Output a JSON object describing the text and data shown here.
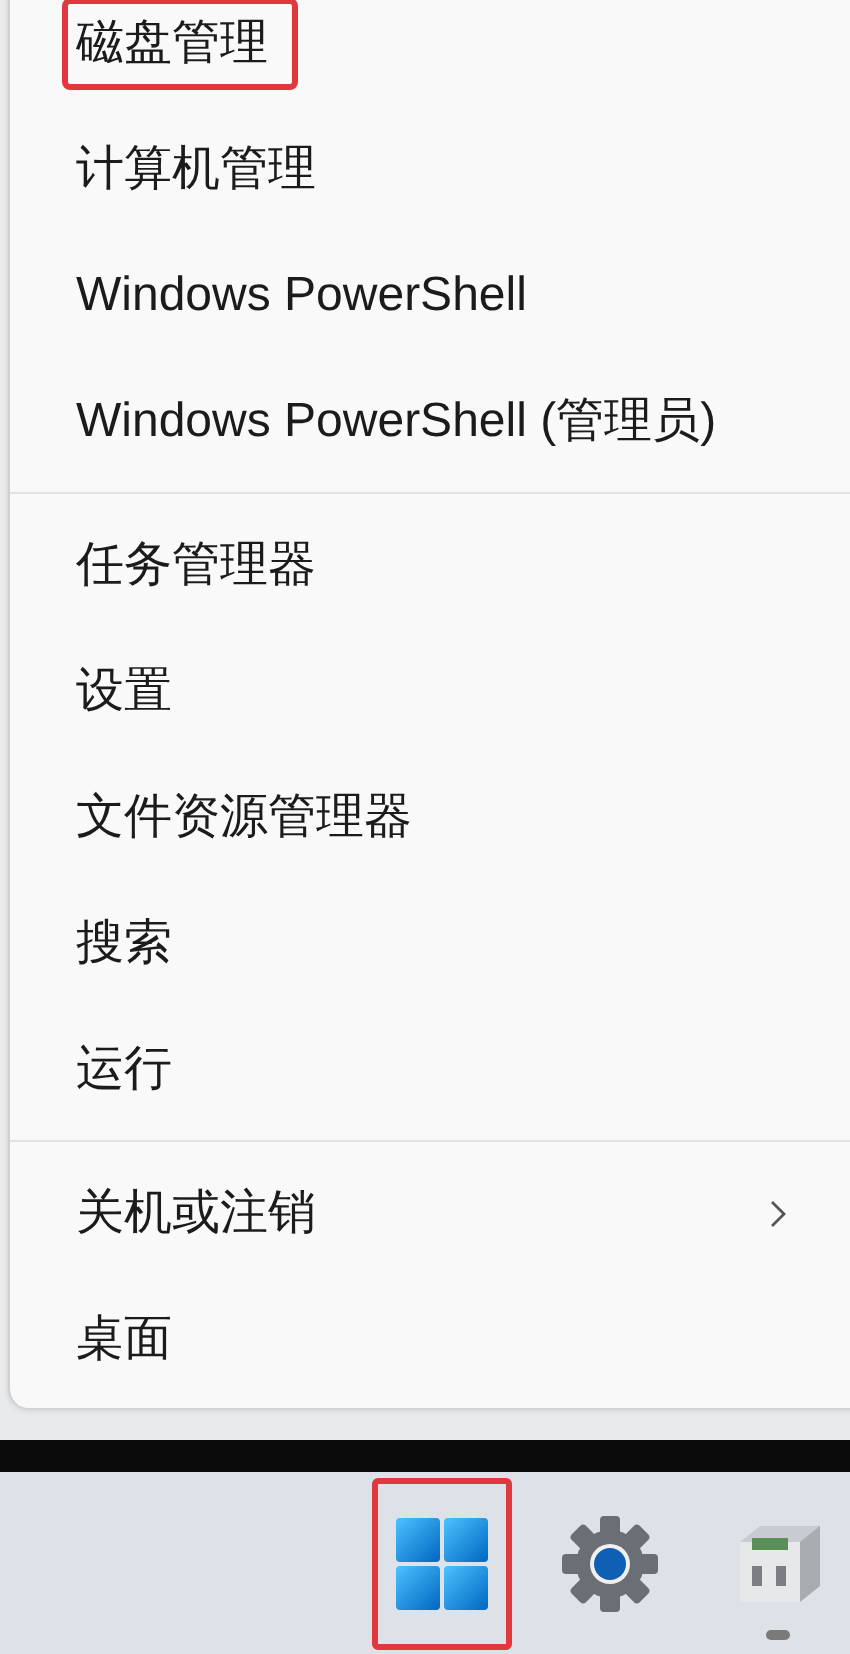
{
  "menu": {
    "items": [
      {
        "kind": "item",
        "label": "磁盘管理",
        "highlighted": true,
        "submenu": false
      },
      {
        "kind": "item",
        "label": "计算机管理",
        "highlighted": false,
        "submenu": false
      },
      {
        "kind": "item",
        "label": "Windows PowerShell",
        "highlighted": false,
        "submenu": false
      },
      {
        "kind": "item",
        "label": "Windows PowerShell (管理员)",
        "highlighted": false,
        "submenu": false
      },
      {
        "kind": "divider"
      },
      {
        "kind": "item",
        "label": "任务管理器",
        "highlighted": false,
        "submenu": false
      },
      {
        "kind": "item",
        "label": "设置",
        "highlighted": false,
        "submenu": false
      },
      {
        "kind": "item",
        "label": "文件资源管理器",
        "highlighted": false,
        "submenu": false
      },
      {
        "kind": "item",
        "label": "搜索",
        "highlighted": false,
        "submenu": false
      },
      {
        "kind": "item",
        "label": "运行",
        "highlighted": false,
        "submenu": false
      },
      {
        "kind": "divider"
      },
      {
        "kind": "item",
        "label": "关机或注销",
        "highlighted": false,
        "submenu": true
      },
      {
        "kind": "item",
        "label": "桌面",
        "highlighted": false,
        "submenu": false
      }
    ]
  },
  "taskbar": {
    "icons": [
      {
        "kind": "start",
        "highlighted": true,
        "running": false
      },
      {
        "kind": "settings",
        "highlighted": false,
        "running": false
      },
      {
        "kind": "app",
        "highlighted": false,
        "running": true
      }
    ]
  }
}
